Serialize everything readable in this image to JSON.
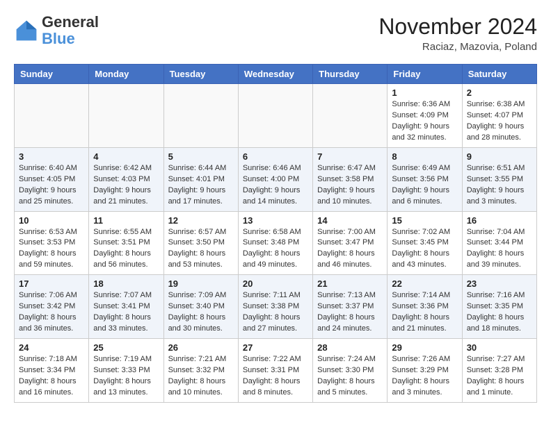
{
  "logo": {
    "text_general": "General",
    "text_blue": "Blue"
  },
  "title": "November 2024",
  "subtitle": "Raciaz, Mazovia, Poland",
  "days_of_week": [
    "Sunday",
    "Monday",
    "Tuesday",
    "Wednesday",
    "Thursday",
    "Friday",
    "Saturday"
  ],
  "weeks": [
    [
      {
        "day": null
      },
      {
        "day": null
      },
      {
        "day": null
      },
      {
        "day": null
      },
      {
        "day": null
      },
      {
        "day": 1,
        "sunrise": "6:36 AM",
        "sunset": "4:09 PM",
        "daylight": "9 hours and 32 minutes."
      },
      {
        "day": 2,
        "sunrise": "6:38 AM",
        "sunset": "4:07 PM",
        "daylight": "9 hours and 28 minutes."
      }
    ],
    [
      {
        "day": 3,
        "sunrise": "6:40 AM",
        "sunset": "4:05 PM",
        "daylight": "9 hours and 25 minutes."
      },
      {
        "day": 4,
        "sunrise": "6:42 AM",
        "sunset": "4:03 PM",
        "daylight": "9 hours and 21 minutes."
      },
      {
        "day": 5,
        "sunrise": "6:44 AM",
        "sunset": "4:01 PM",
        "daylight": "9 hours and 17 minutes."
      },
      {
        "day": 6,
        "sunrise": "6:46 AM",
        "sunset": "4:00 PM",
        "daylight": "9 hours and 14 minutes."
      },
      {
        "day": 7,
        "sunrise": "6:47 AM",
        "sunset": "3:58 PM",
        "daylight": "9 hours and 10 minutes."
      },
      {
        "day": 8,
        "sunrise": "6:49 AM",
        "sunset": "3:56 PM",
        "daylight": "9 hours and 6 minutes."
      },
      {
        "day": 9,
        "sunrise": "6:51 AM",
        "sunset": "3:55 PM",
        "daylight": "9 hours and 3 minutes."
      }
    ],
    [
      {
        "day": 10,
        "sunrise": "6:53 AM",
        "sunset": "3:53 PM",
        "daylight": "8 hours and 59 minutes."
      },
      {
        "day": 11,
        "sunrise": "6:55 AM",
        "sunset": "3:51 PM",
        "daylight": "8 hours and 56 minutes."
      },
      {
        "day": 12,
        "sunrise": "6:57 AM",
        "sunset": "3:50 PM",
        "daylight": "8 hours and 53 minutes."
      },
      {
        "day": 13,
        "sunrise": "6:58 AM",
        "sunset": "3:48 PM",
        "daylight": "8 hours and 49 minutes."
      },
      {
        "day": 14,
        "sunrise": "7:00 AM",
        "sunset": "3:47 PM",
        "daylight": "8 hours and 46 minutes."
      },
      {
        "day": 15,
        "sunrise": "7:02 AM",
        "sunset": "3:45 PM",
        "daylight": "8 hours and 43 minutes."
      },
      {
        "day": 16,
        "sunrise": "7:04 AM",
        "sunset": "3:44 PM",
        "daylight": "8 hours and 39 minutes."
      }
    ],
    [
      {
        "day": 17,
        "sunrise": "7:06 AM",
        "sunset": "3:42 PM",
        "daylight": "8 hours and 36 minutes."
      },
      {
        "day": 18,
        "sunrise": "7:07 AM",
        "sunset": "3:41 PM",
        "daylight": "8 hours and 33 minutes."
      },
      {
        "day": 19,
        "sunrise": "7:09 AM",
        "sunset": "3:40 PM",
        "daylight": "8 hours and 30 minutes."
      },
      {
        "day": 20,
        "sunrise": "7:11 AM",
        "sunset": "3:38 PM",
        "daylight": "8 hours and 27 minutes."
      },
      {
        "day": 21,
        "sunrise": "7:13 AM",
        "sunset": "3:37 PM",
        "daylight": "8 hours and 24 minutes."
      },
      {
        "day": 22,
        "sunrise": "7:14 AM",
        "sunset": "3:36 PM",
        "daylight": "8 hours and 21 minutes."
      },
      {
        "day": 23,
        "sunrise": "7:16 AM",
        "sunset": "3:35 PM",
        "daylight": "8 hours and 18 minutes."
      }
    ],
    [
      {
        "day": 24,
        "sunrise": "7:18 AM",
        "sunset": "3:34 PM",
        "daylight": "8 hours and 16 minutes."
      },
      {
        "day": 25,
        "sunrise": "7:19 AM",
        "sunset": "3:33 PM",
        "daylight": "8 hours and 13 minutes."
      },
      {
        "day": 26,
        "sunrise": "7:21 AM",
        "sunset": "3:32 PM",
        "daylight": "8 hours and 10 minutes."
      },
      {
        "day": 27,
        "sunrise": "7:22 AM",
        "sunset": "3:31 PM",
        "daylight": "8 hours and 8 minutes."
      },
      {
        "day": 28,
        "sunrise": "7:24 AM",
        "sunset": "3:30 PM",
        "daylight": "8 hours and 5 minutes."
      },
      {
        "day": 29,
        "sunrise": "7:26 AM",
        "sunset": "3:29 PM",
        "daylight": "8 hours and 3 minutes."
      },
      {
        "day": 30,
        "sunrise": "7:27 AM",
        "sunset": "3:28 PM",
        "daylight": "8 hours and 1 minute."
      }
    ]
  ]
}
